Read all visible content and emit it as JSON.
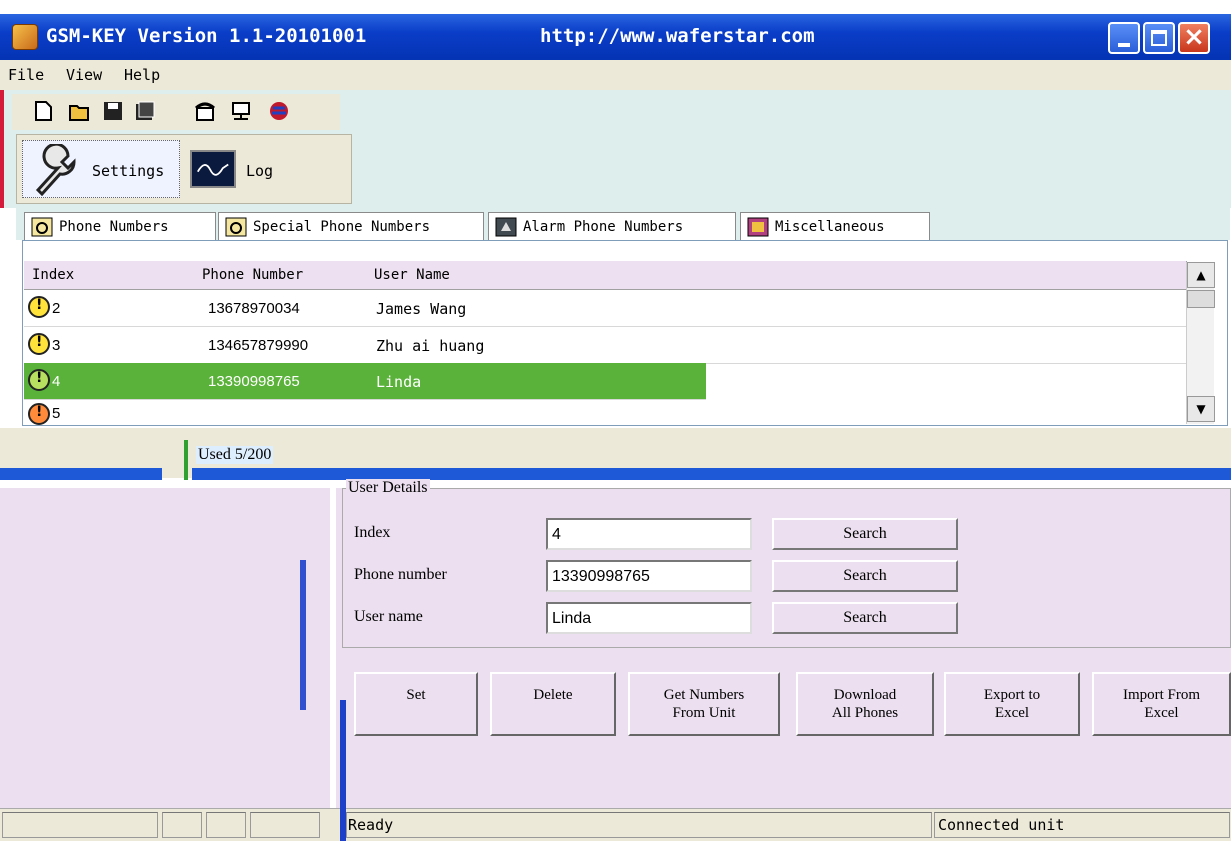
{
  "window": {
    "title": "GSM-KEY Version 1.1-20101001",
    "url": "http://www.waferstar.com"
  },
  "menu": [
    "File",
    "View",
    "Help"
  ],
  "toolbar_icons": [
    "new-icon",
    "open-icon",
    "save-icon",
    "save-as-icon",
    "phone-icon",
    "network-icon",
    "globe-icon"
  ],
  "tools": {
    "settings_label": "Settings",
    "log_label": "Log"
  },
  "tabs": [
    {
      "label": "Phone Numbers",
      "active": true
    },
    {
      "label": "Special Phone Numbers",
      "active": false
    },
    {
      "label": "Alarm Phone Numbers",
      "active": false
    },
    {
      "label": "Miscellaneous",
      "active": false
    }
  ],
  "table": {
    "columns": [
      "Index",
      "Phone Number",
      "User Name",
      ""
    ],
    "rows": [
      {
        "index": "2",
        "phone": "13678970034",
        "name": "James Wang",
        "selected": false
      },
      {
        "index": "3",
        "phone": "134657879990",
        "name": "Zhu ai huang",
        "selected": false
      },
      {
        "index": "4",
        "phone": "13390998765",
        "name": "Linda",
        "selected": true
      },
      {
        "index": "5",
        "phone": "",
        "name": "",
        "selected": false
      }
    ]
  },
  "used": "Used 5/200",
  "details": {
    "legend": "User Details",
    "index_label": "Index",
    "index_value": "4",
    "phone_label": "Phone number",
    "phone_value": "13390998765",
    "name_label": "User name",
    "name_value": "Linda",
    "search_label": "Search"
  },
  "actions": [
    {
      "label": "Set",
      "line2": ""
    },
    {
      "label": "Delete",
      "line2": ""
    },
    {
      "label": "Get Numbers",
      "line2": "From Unit"
    },
    {
      "label": "Download",
      "line2": "All Phones"
    },
    {
      "label": "Export to",
      "line2": "Excel"
    },
    {
      "label": "Import From",
      "line2": "Excel"
    }
  ],
  "status": {
    "ready": "Ready",
    "connection": "Connected unit"
  },
  "colors": {
    "selected_row": "#5ab23a",
    "titlebar": "#0a3dc8",
    "panel": "#ece0f0"
  }
}
